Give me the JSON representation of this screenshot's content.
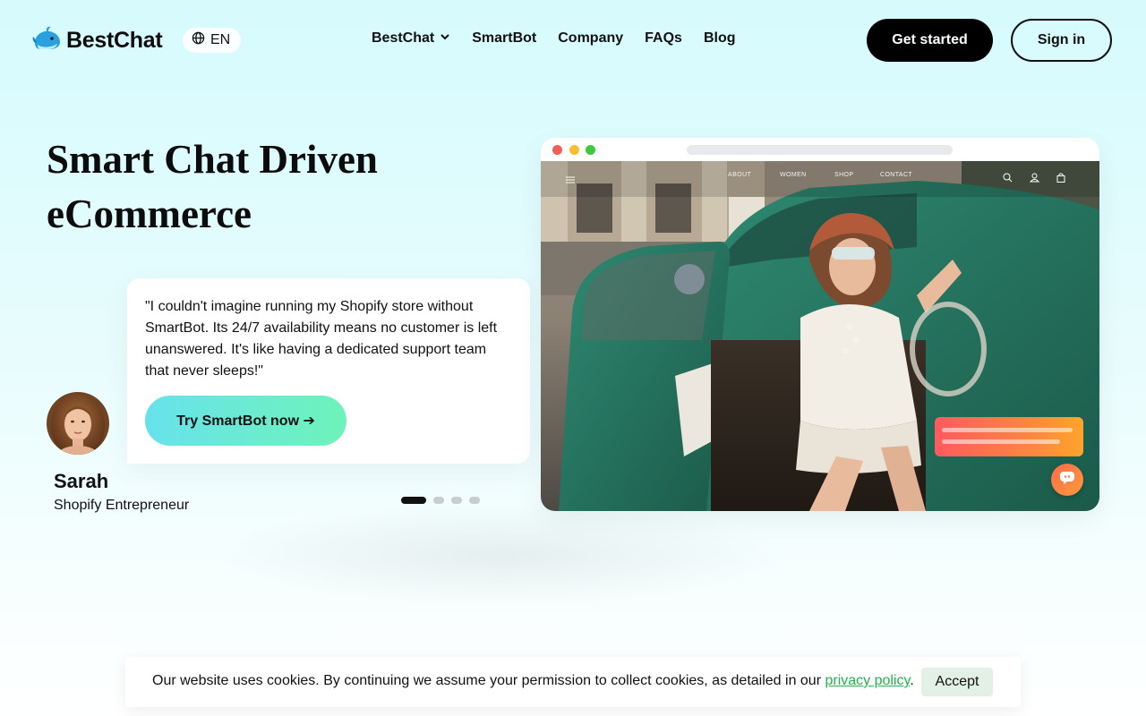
{
  "header": {
    "logo_text": "BestChat",
    "logo_icon": "whale-icon",
    "language": "EN",
    "language_icon": "globe-icon",
    "nav": [
      {
        "label": "BestChat",
        "has_dropdown": true
      },
      {
        "label": "SmartBot"
      },
      {
        "label": "Company"
      },
      {
        "label": "FAQs"
      },
      {
        "label": "Blog"
      }
    ],
    "get_started_label": "Get started",
    "sign_in_label": "Sign in"
  },
  "hero": {
    "title_line1": "Smart Chat Driven",
    "title_line2": "eCommerce",
    "testimonial": {
      "quote": "\"I couldn't imagine running my Shopify store without SmartBot. Its 24/7 availability means no customer is left unanswered. It's like having a dedicated support team that never sleeps!\"",
      "cta_label": "Try SmartBot now ➔",
      "name": "Sarah",
      "role": "Shopify Entrepreneur"
    },
    "carousel": {
      "count": 4,
      "active_index": 0
    }
  },
  "browser_mock": {
    "site_nav": [
      "ABOUT",
      "WOMEN",
      "SHOP",
      "CONTACT"
    ],
    "icons": [
      "menu-icon",
      "search-icon",
      "user-icon",
      "bag-icon",
      "chat-icon"
    ]
  },
  "cookie_banner": {
    "text_before": "Our website uses cookies. By continuing we assume your permission to collect cookies, as detailed in our ",
    "link_text": "privacy policy",
    "text_after": ".",
    "accept_label": "Accept"
  },
  "colors": {
    "accent_black": "#000000",
    "cta_gradient_start": "#67e2ec",
    "cta_gradient_end": "#6ef3b9",
    "link_green": "#22b24c",
    "chat_orange": "#ff8a3d"
  }
}
